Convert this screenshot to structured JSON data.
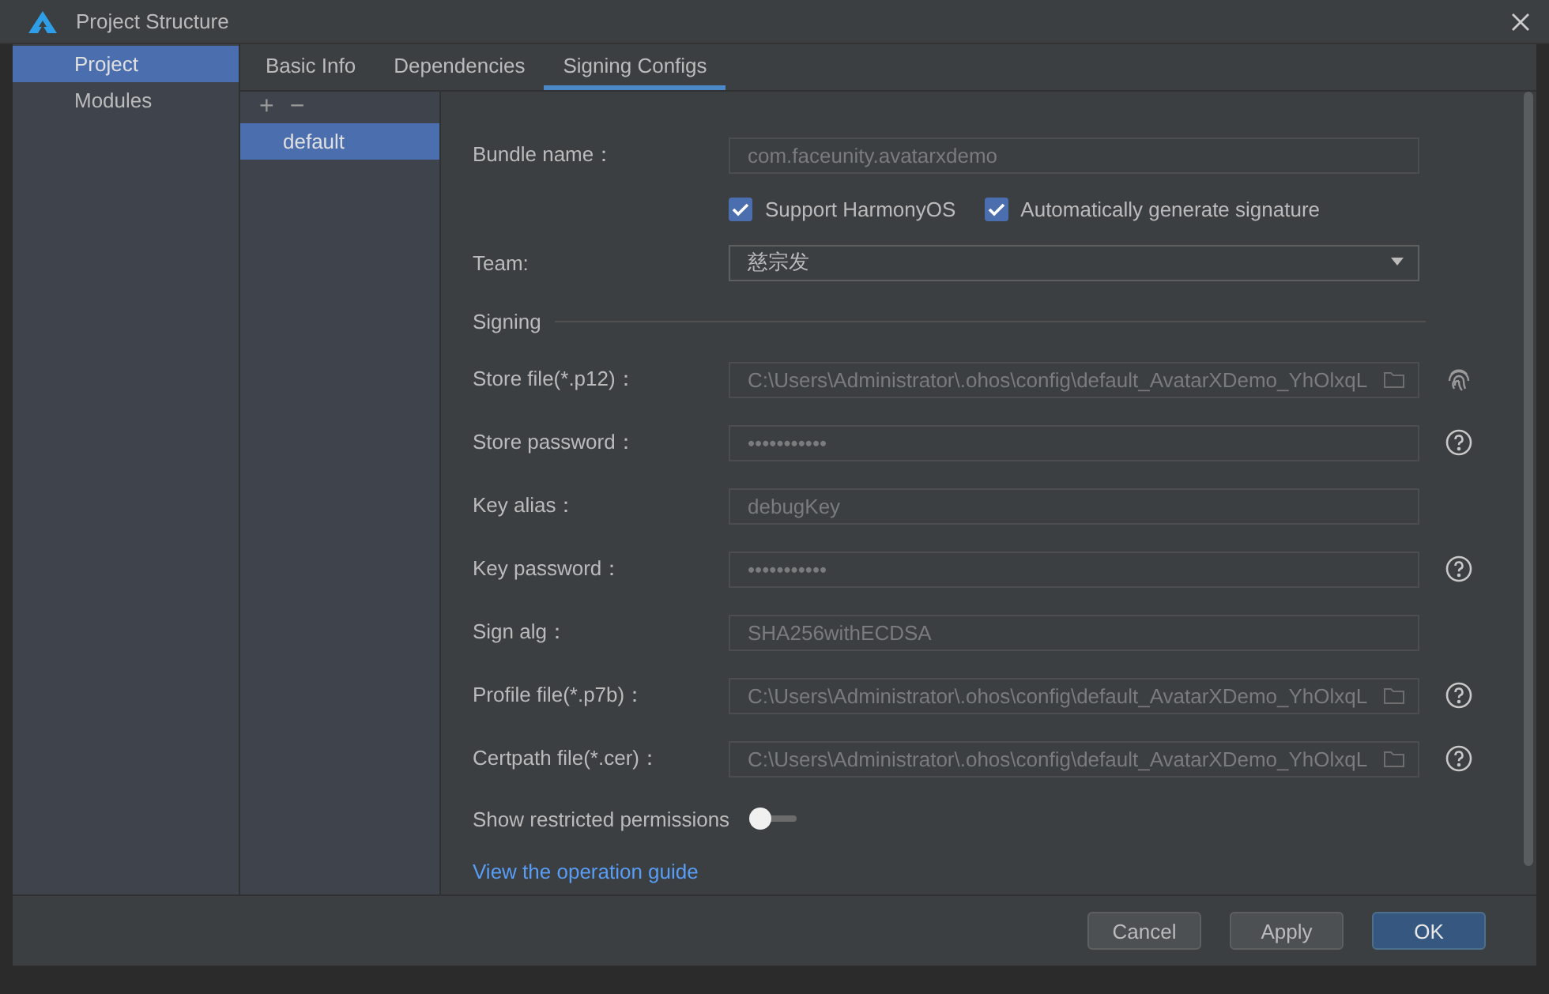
{
  "window": {
    "title": "Project Structure"
  },
  "sidebar": {
    "items": [
      {
        "label": "Project",
        "selected": true
      },
      {
        "label": "Modules",
        "selected": false
      }
    ]
  },
  "tabs": [
    {
      "label": "Basic Info",
      "selected": false
    },
    {
      "label": "Dependencies",
      "selected": false
    },
    {
      "label": "Signing Configs",
      "selected": true
    }
  ],
  "configs": {
    "toolbar": [
      "+",
      "−"
    ],
    "items": [
      {
        "label": "default",
        "selected": true
      }
    ]
  },
  "form": {
    "rows": [
      {
        "kind": "text",
        "label": "Bundle name：",
        "value": "com.faceunity.avatarxdemo"
      },
      {
        "kind": "checks",
        "items": [
          {
            "label": "Support HarmonyOS",
            "checked": true
          },
          {
            "label": "Automatically generate signature",
            "checked": true
          }
        ]
      },
      {
        "kind": "dropdown",
        "label": "Team:",
        "value": "慈宗发"
      },
      {
        "kind": "section",
        "label": "Signing"
      },
      {
        "kind": "file",
        "label": "Store file(*.p12)：",
        "value": "C:\\Users\\Administrator\\.ohos\\config\\default_AvatarXDemo_YhOlxqL",
        "side_button": {
          "kind": "fingerprint"
        }
      },
      {
        "kind": "password",
        "label": "Store password：",
        "value": "•••••••••••",
        "side_button": {
          "kind": "help"
        }
      },
      {
        "kind": "text",
        "label": "Key alias：",
        "value": "debugKey"
      },
      {
        "kind": "password",
        "label": "Key password：",
        "value": "•••••••••••",
        "side_button": {
          "kind": "help"
        }
      },
      {
        "kind": "text",
        "label": "Sign alg：",
        "value": "SHA256withECDSA"
      },
      {
        "kind": "file",
        "label": "Profile file(*.p7b)：",
        "value": "C:\\Users\\Administrator\\.ohos\\config\\default_AvatarXDemo_YhOlxqL",
        "side_button": {
          "kind": "help"
        }
      },
      {
        "kind": "file",
        "label": "Certpath file(*.cer)：",
        "value": "C:\\Users\\Administrator\\.ohos\\config\\default_AvatarXDemo_YhOlxqL",
        "side_button": {
          "kind": "help"
        }
      },
      {
        "kind": "toggle",
        "label": "Show restricted permissions",
        "on": false
      },
      {
        "kind": "link",
        "label": "View the operation guide"
      }
    ]
  },
  "buttons": [
    {
      "label": "Cancel",
      "kind": "secondary"
    },
    {
      "label": "Apply",
      "kind": "secondary"
    },
    {
      "label": "OK",
      "kind": "primary"
    }
  ]
}
